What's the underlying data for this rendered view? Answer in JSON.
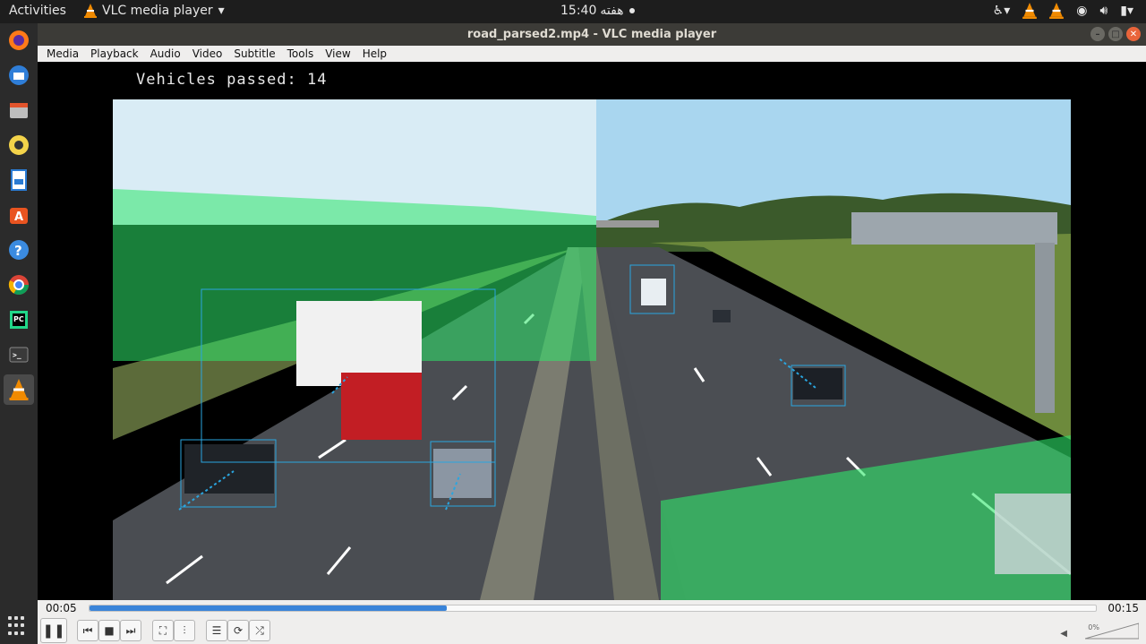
{
  "topbar": {
    "activities": "Activities",
    "app_name": "VLC media player",
    "clock": "15:40",
    "day": "هفته"
  },
  "window": {
    "title": "road_parsed2.mp4 - VLC media player"
  },
  "menu": {
    "items": [
      "Media",
      "Playback",
      "Audio",
      "Video",
      "Subtitle",
      "Tools",
      "View",
      "Help"
    ]
  },
  "video": {
    "overlay_text": "Vehicles passed: 14"
  },
  "playback": {
    "elapsed": "00:05",
    "total": "00:15",
    "progress": 0.355,
    "volume_label": "0%"
  },
  "colors": {
    "accent": "#3a84d9",
    "overlay_green": "#2ee86a",
    "detection_box": "#2aa6e0"
  },
  "icons": {
    "dock": [
      "firefox-icon",
      "thunderbird-icon",
      "files-icon",
      "rhythmbox-icon",
      "writer-icon",
      "software-center-icon",
      "help-icon",
      "chrome-icon",
      "pycharm-icon",
      "terminal-icon",
      "vlc-icon",
      "show-apps-icon"
    ],
    "controls": [
      "pause-icon",
      "previous-icon",
      "stop-icon",
      "next-icon",
      "fullscreen-icon",
      "extended-settings-icon",
      "playlist-icon",
      "loop-icon",
      "shuffle-icon"
    ]
  }
}
